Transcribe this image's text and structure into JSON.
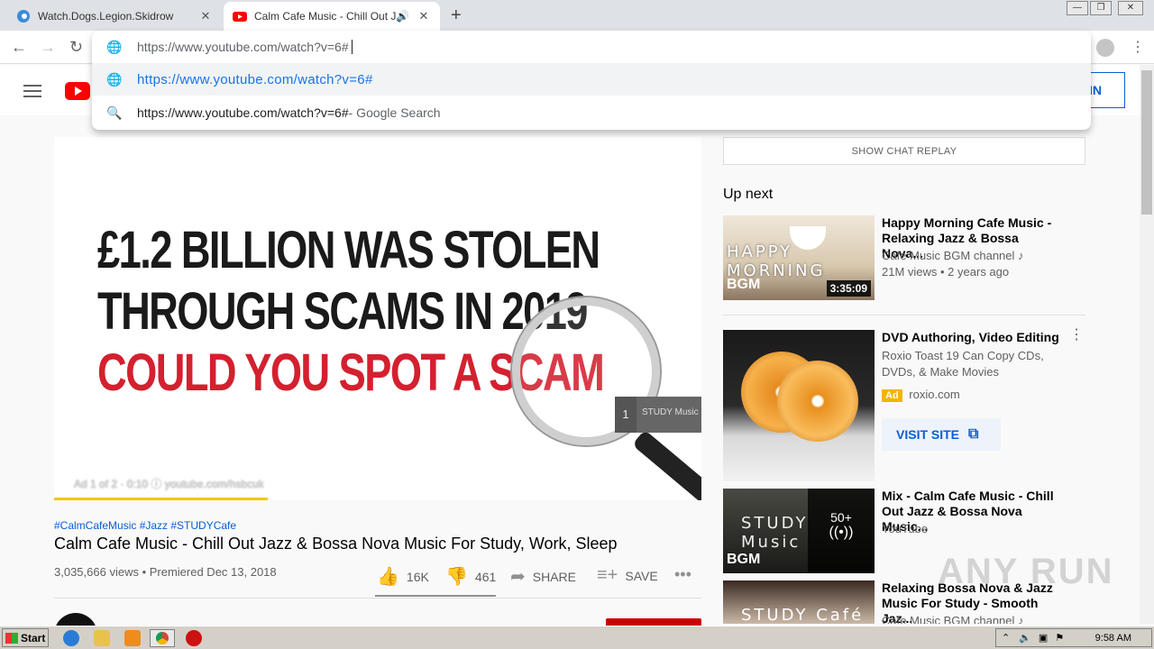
{
  "browser": {
    "tabs": [
      {
        "title": "Watch.Dogs.Legion.Skidrow",
        "favicon": "edge-swirl-icon",
        "active": false
      },
      {
        "title": "Calm Cafe Music - Chill Out Jazz",
        "favicon": "youtube-icon",
        "active": true
      }
    ],
    "new_tab": "+",
    "omnibox": {
      "input_value": "https://www.youtube.com/watch?v=6#",
      "suggestion_url": "https://www.youtube.com/watch?v=6#",
      "search_query": "https://www.youtube.com/watch?v=6#",
      "search_suffix": " - Google Search"
    }
  },
  "youtube": {
    "signin_label": "IN",
    "player": {
      "headline_1": "£1.2 BILLION WAS STOLEN",
      "headline_2": "THROUGH SCAMS IN 2019",
      "headline_3": "COULD YOU SPOT A SCAM",
      "ad_info": "Ad 1 of 2 · 0:10 ⓘ   youtube.com/hsbcuk",
      "ad_queue_number": "1",
      "ad_queue_label": "STUDY Music",
      "progress": 0.33
    },
    "video": {
      "hashtags": "#CalmCafeMusic #Jazz #STUDYCafe",
      "title": "Calm Cafe Music - Chill Out Jazz & Bossa Nova Music For Study, Work, Sleep",
      "meta": "3,035,666 views • Premiered Dec 13, 2018",
      "likes": "16K",
      "dislikes": "461",
      "share_label": "SHARE",
      "save_label": "SAVE"
    },
    "sidebar": {
      "chat_replay_label": "SHOW CHAT REPLAY",
      "up_next_label": "Up next",
      "items": [
        {
          "title": "Happy Morning Cafe Music - Relaxing Jazz & Bossa Nova...",
          "channel": "Cafe Music BGM channel ♪",
          "meta": "21M views • 2 years ago",
          "duration": "3:35:09",
          "thumb_text": "HAPPY MORNING",
          "thumb_brand": "BGM"
        },
        {
          "title": "DVD Authoring, Video Editing",
          "description": "Roxio Toast 19 Can Copy CDs, DVDs, & Make Movies",
          "ad_badge": "Ad",
          "advertiser": "roxio.com",
          "visit_label": "VISIT SITE"
        },
        {
          "title": "Mix - Calm Cafe Music - Chill Out Jazz & Bossa Nova Music...",
          "channel": "YouTube",
          "mix_count": "50+",
          "thumb_text": "STUDY Music",
          "thumb_brand": "BGM"
        },
        {
          "title": "Relaxing Bossa Nova & Jazz Music For Study - Smooth Jaz...",
          "channel": "Cafe Music BGM channel ♪",
          "thumb_text": "STUDY Café"
        }
      ]
    }
  },
  "watermark": "ANY RUN",
  "taskbar": {
    "start_label": "Start",
    "clock": "9:58 AM"
  }
}
